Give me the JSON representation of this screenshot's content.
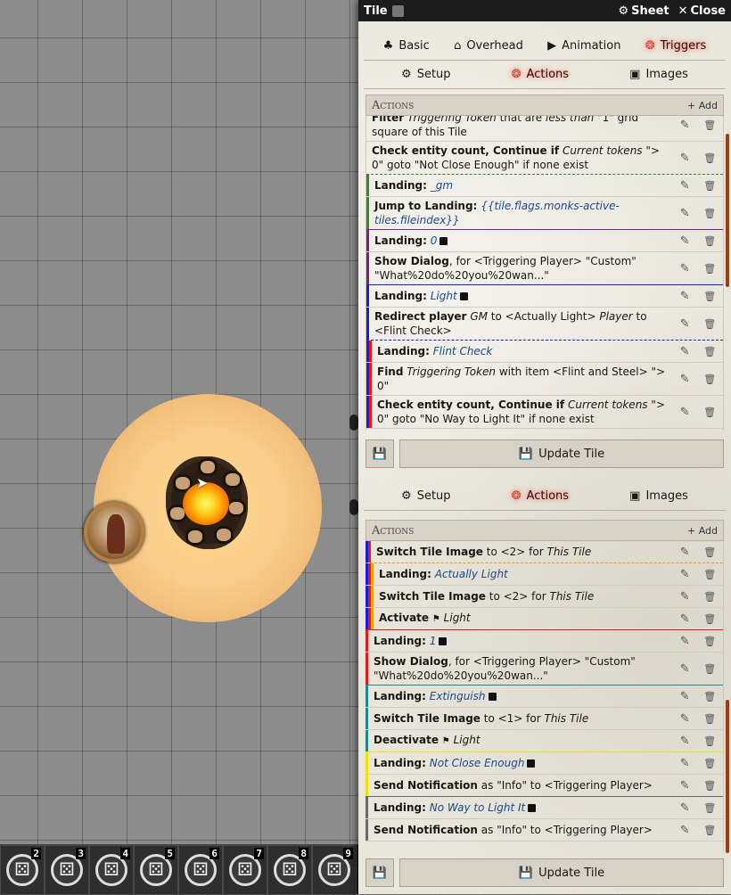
{
  "window": {
    "title": "Tile",
    "sheet_label": "Sheet",
    "close_label": "Close"
  },
  "tabs_primary": [
    {
      "label": "Basic",
      "icon": "cubes-icon"
    },
    {
      "label": "Overhead",
      "icon": "home-icon"
    },
    {
      "label": "Animation",
      "icon": "play-icon"
    },
    {
      "label": "Triggers",
      "icon": "running-icon",
      "active": true
    }
  ],
  "tabs_secondary": [
    {
      "label": "Setup",
      "icon": "gear-icon"
    },
    {
      "label": "Actions",
      "icon": "running-icon",
      "active": true
    },
    {
      "label": "Images",
      "icon": "image-icon"
    }
  ],
  "actions_header": {
    "title": "Actions",
    "add_label": "Add"
  },
  "panel1_rows": [
    {
      "html": "<b>Filter</b> <i>Triggering Token</i> that are <i>less than</i> \"1\" grid square of this Tile"
    },
    {
      "html": "<b>Check entity count, Continue if</b> <i>Current tokens</i> \"> 0\" goto \"Not Close Enough\" if none exist"
    },
    {
      "html": "<b>Landing:</b> <span class='lnd'>_gm</span>"
    },
    {
      "html": "<b>Jump to Landing:</b> <span class='lnd'>{{tile.flags.monks-active-tiles.fileindex}}</span>"
    },
    {
      "html": "<b>Landing:</b> <span class='lnd'>0</span><span class='sq'></span>"
    },
    {
      "html": "<b>Show Dialog</b>, for &lt;Triggering Player&gt; \"Custom\" \"What%20do%20you%20wan...\""
    },
    {
      "html": "<b>Landing:</b> <span class='lnd'>Light</span><span class='sq'></span>"
    },
    {
      "html": "<b>Redirect player</b> <i>GM</i> to &lt;Actually Light&gt; <i>Player</i> to &lt;Flint Check&gt;"
    },
    {
      "html": "<b>Landing:</b> <span class='lnd'>Flint Check</span>"
    },
    {
      "html": "<b>Find</b> <i>Triggering Token</i> with item &lt;Flint and Steel&gt; \"> 0\""
    },
    {
      "html": "<b>Check entity count, Continue if</b> <i>Current tokens</i> \"> 0\" goto \"No Way to Light It\" if none exist"
    }
  ],
  "panel2_rows": [
    {
      "html": "<b>Switch Tile Image</b> to &lt;2&gt; for <i>This Tile</i>"
    },
    {
      "html": "<b>Landing:</b> <span class='lnd'>Actually Light</span>"
    },
    {
      "html": "<b>Switch Tile Image</b> to &lt;2&gt; for <i>This Tile</i>"
    },
    {
      "html": "<b>Activate</b> <span class='tag'>&#9873;</span> <i>Light</i>"
    },
    {
      "html": "<b>Landing:</b> <span class='lnd'>1</span><span class='sq'></span>"
    },
    {
      "html": "<b>Show Dialog</b>, for &lt;Triggering Player&gt; \"Custom\" \"What%20do%20you%20wan...\""
    },
    {
      "html": "<b>Landing:</b> <span class='lnd'>Extinguish</span><span class='sq'></span>"
    },
    {
      "html": "<b>Switch Tile Image</b> to &lt;1&gt; for <i>This Tile</i>"
    },
    {
      "html": "<b>Deactivate</b> <span class='tag'>&#9873;</span> <i>Light</i>"
    },
    {
      "html": "<b>Landing:</b> <span class='lnd'>Not Close Enough</span><span class='sq'></span>"
    },
    {
      "html": "<b>Send Notification</b> as \"Info\" to &lt;Triggering Player&gt;"
    },
    {
      "html": "<b>Landing:</b> <span class='lnd'>No Way to Light It</span><span class='sq'></span>"
    },
    {
      "html": "<b>Send Notification</b> as \"Info\" to &lt;Triggering Player&gt;"
    }
  ],
  "update_label": "Update Tile",
  "hotbar": [
    "2",
    "3",
    "4",
    "5",
    "6",
    "7",
    "8",
    "9"
  ],
  "colors": {
    "green": "#2e8b2e",
    "purple": "#7a1f8a",
    "blue": "#1a1ae6",
    "red": "#e81818",
    "orange": "#f0a000",
    "teal": "#1a8a8a",
    "yellow": "#f2e200",
    "gray": "#6a6a6a",
    "brown": "#a33a12"
  }
}
